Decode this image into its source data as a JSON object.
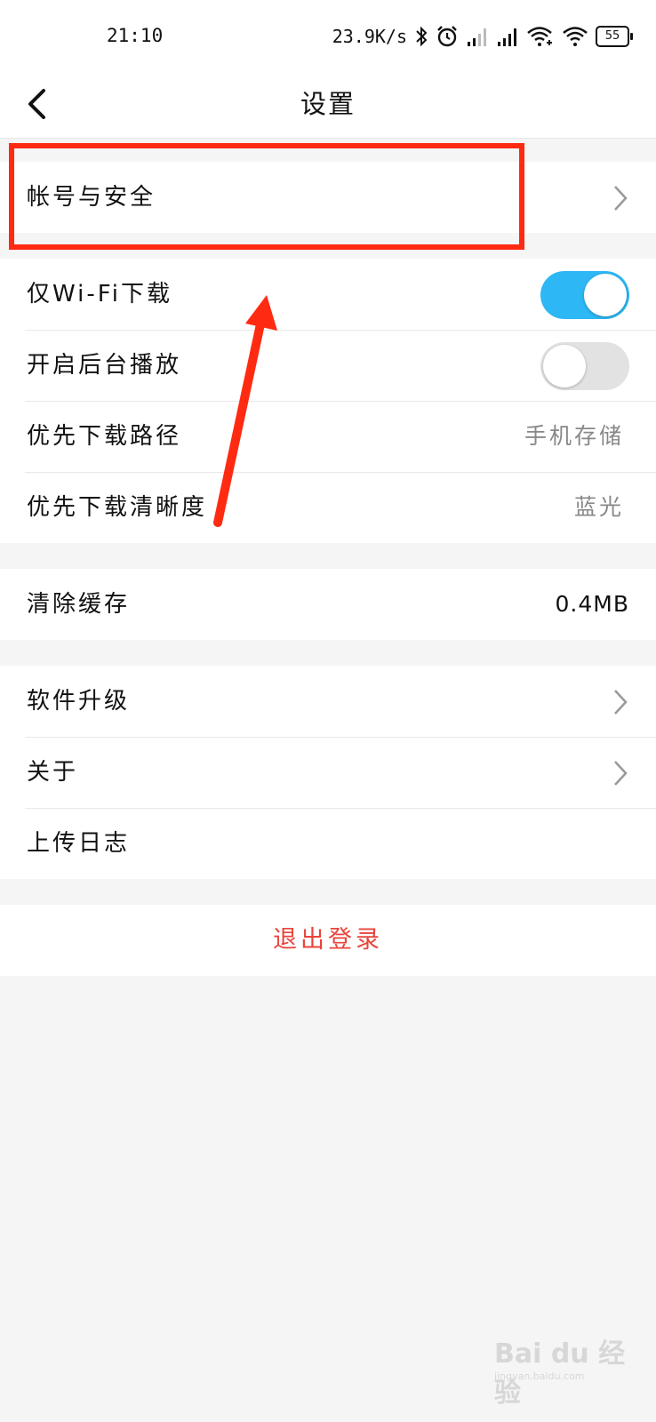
{
  "status_bar": {
    "time": "21:10",
    "net_speed": "23.9K/s",
    "battery": "55"
  },
  "header": {
    "title": "设置"
  },
  "account_group": {
    "account_security": "帐号与安全"
  },
  "download_group": {
    "wifi_only": {
      "label": "仅Wi-Fi下载",
      "enabled": true
    },
    "background_play": {
      "label": "开启后台播放",
      "enabled": false
    },
    "download_path": {
      "label": "优先下载路径",
      "value": "手机存储"
    },
    "download_quality": {
      "label": "优先下载清晰度",
      "value": "蓝光"
    }
  },
  "cache_group": {
    "clear_cache": {
      "label": "清除缓存",
      "value": "0.4MB"
    }
  },
  "misc_group": {
    "software_upgrade": "软件升级",
    "about": "关于",
    "upload_log": "上传日志"
  },
  "logout": "退出登录",
  "watermark": {
    "brand": "Bai du 经验",
    "url": "jingyan.baidu.com"
  },
  "colors": {
    "toggle_on": "#2db7f5",
    "logout_text": "#e8453c",
    "annotation_red": "#ff2a12"
  }
}
